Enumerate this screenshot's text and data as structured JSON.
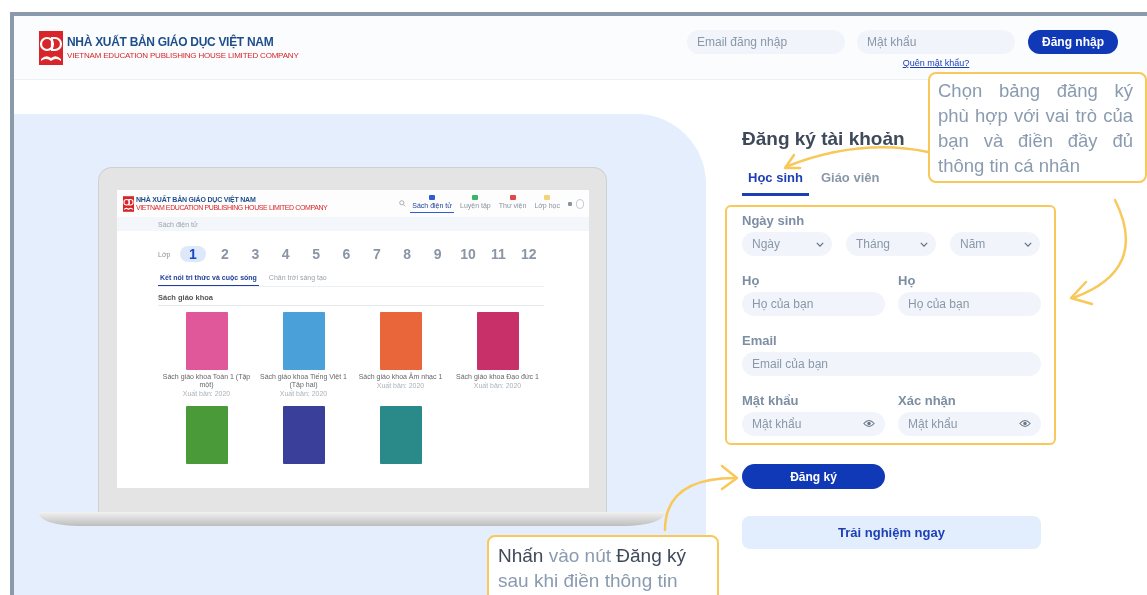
{
  "header": {
    "logo": {
      "title": "NHÀ XUẤT BẢN GIÁO DỤC VIỆT NAM",
      "subtitle": "VIETNAM EDUCATION PUBLISHING HOUSE LIMITED COMPANY"
    },
    "login": {
      "email_placeholder": "Email đăng nhập",
      "password_placeholder": "Mật khẩu",
      "button": "Đăng nhập",
      "forgot_link": "Quên mật khẩu?"
    }
  },
  "preview": {
    "logo": {
      "title": "NHÀ XUẤT BẢN GIÁO DỤC VIỆT NAM",
      "subtitle": "VIETNAM EDUCATION PUBLISHING HOUSE LIMITED COMPANY"
    },
    "nav": [
      {
        "label": "Sách điện tử",
        "selected": true,
        "color": "#2f5bd3"
      },
      {
        "label": "Luyện tập",
        "selected": false,
        "color": "#3cb46e"
      },
      {
        "label": "Thư viện",
        "selected": false,
        "color": "#e04848"
      },
      {
        "label": "Lớp học",
        "selected": false,
        "color": "#f3d27a"
      }
    ],
    "breadcrumb": "Sách điện tử",
    "grade_label": "Lớp",
    "grades": [
      {
        "label": "1",
        "selected": true
      },
      {
        "label": "2",
        "selected": false
      },
      {
        "label": "3",
        "selected": false
      },
      {
        "label": "4",
        "selected": false
      },
      {
        "label": "5",
        "selected": false
      },
      {
        "label": "6",
        "selected": false
      },
      {
        "label": "7",
        "selected": false
      },
      {
        "label": "8",
        "selected": false
      },
      {
        "label": "9",
        "selected": false
      },
      {
        "label": "10",
        "selected": false
      },
      {
        "label": "11",
        "selected": false
      },
      {
        "label": "12",
        "selected": false
      }
    ],
    "series_tabs": [
      {
        "label": "Kết nối tri thức và cuộc sống",
        "selected": true
      },
      {
        "label": "Chân trời sáng tạo",
        "selected": false
      }
    ],
    "section_title": "Sách giáo khoa",
    "books": [
      {
        "title": "Sách giáo khoa Toán 1 (Tập một)",
        "published": "Xuất bản: 2020",
        "color": "#e0579a"
      },
      {
        "title": "Sách giáo khoa Tiếng Việt 1 (Tập hai)",
        "published": "Xuất bản: 2020",
        "color": "#4aa0d8"
      },
      {
        "title": "Sách giáo khoa Âm nhạc 1",
        "published": "Xuất bản: 2020",
        "color": "#e8663a"
      },
      {
        "title": "Sách giáo khoa Đạo đức 1",
        "published": "Xuất bản: 2020",
        "color": "#c8306a"
      },
      {
        "color": "#4a9a3a"
      },
      {
        "color": "#3a3f9a"
      },
      {
        "color": "#2a8a8a"
      }
    ]
  },
  "form": {
    "title": "Đăng ký tài khoản",
    "roles": [
      {
        "label": "Học sinh",
        "selected": true
      },
      {
        "label": "Giáo viên",
        "selected": false
      }
    ],
    "birthdate": {
      "label": "Ngày sinh",
      "selects": [
        "Ngày",
        "Tháng",
        "Năm"
      ]
    },
    "rows": [
      [
        {
          "label": "Họ",
          "placeholder": "Họ của bạn",
          "kind": "text"
        },
        {
          "label": "Họ",
          "placeholder": "Họ của bạn",
          "kind": "text"
        }
      ],
      [
        {
          "label": "Email",
          "placeholder": "Email của bạn",
          "kind": "text"
        }
      ],
      [
        {
          "label": "Mật khẩu",
          "placeholder": "Mật khẩu",
          "kind": "password"
        },
        {
          "label": "Xác nhận",
          "placeholder": "Mật khẩu",
          "kind": "password"
        }
      ]
    ],
    "submit": "Đăng ký",
    "trial": "Trải nghiệm ngay"
  },
  "annotations": [
    {
      "kind": "roles",
      "segments": [
        {
          "text": "Chọn bảng đăng ký phù hợp với vai trò của bạn và điền đầy đủ thông tin cá nhân",
          "emphasis": false
        }
      ]
    },
    {
      "kind": "submit",
      "segments": [
        {
          "text": "Nhấn",
          "emphasis": true
        },
        {
          "text": " vào nút ",
          "emphasis": false
        },
        {
          "text": "Đăng ký",
          "emphasis": true
        },
        {
          "text": " sau khi điền thông tin",
          "emphasis": false
        }
      ]
    }
  ]
}
